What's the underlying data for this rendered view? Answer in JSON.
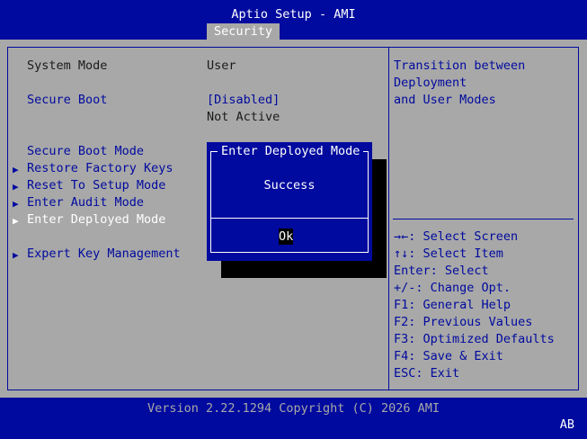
{
  "header": {
    "title": "Aptio Setup - AMI",
    "active_tab": "Security"
  },
  "settings": {
    "system_mode": {
      "label": "System Mode",
      "value": "User"
    },
    "secure_boot": {
      "label": "Secure Boot",
      "value": "[Disabled]",
      "status": "Not Active"
    },
    "secure_boot_mode": {
      "label": "Secure Boot Mode"
    },
    "restore_factory_keys": {
      "label": "Restore Factory Keys"
    },
    "reset_to_setup_mode": {
      "label": "Reset To Setup Mode"
    },
    "enter_audit_mode": {
      "label": "Enter Audit Mode"
    },
    "enter_deployed_mode": {
      "label": "Enter Deployed Mode"
    },
    "expert_key_management": {
      "label": "Expert Key Management"
    }
  },
  "help_text": {
    "line1": "Transition between",
    "line2": "Deployment",
    "line3": "and User Modes"
  },
  "key_help": {
    "select_screen": "→←: Select Screen",
    "select_item": "↑↓: Select Item",
    "enter": "Enter: Select",
    "change": "+/-: Change Opt.",
    "f1": "F1: General Help",
    "f2": "F2: Previous Values",
    "f3": "F3: Optimized Defaults",
    "f4": "F4: Save & Exit",
    "esc": "ESC: Exit"
  },
  "dialog": {
    "title": "Enter Deployed Mode",
    "message": "Success",
    "ok_label": "Ok"
  },
  "footer": {
    "version": "Version 2.22.1294 Copyright (C) 2026 AMI",
    "badge": "AB"
  },
  "colors": {
    "bios_blue": "#000a9e",
    "panel_gray": "#a8a8a8",
    "white": "#ffffff",
    "black": "#000000"
  }
}
